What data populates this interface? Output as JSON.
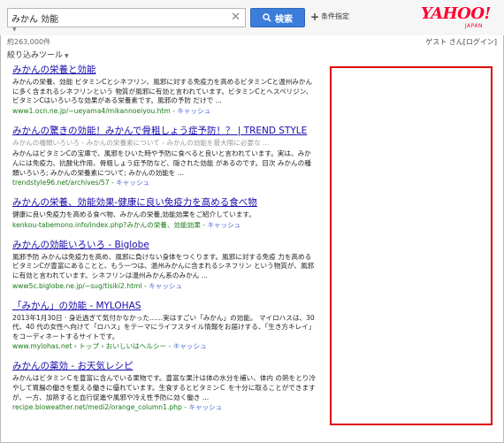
{
  "search": {
    "query": "みかん 効能",
    "button_label": "検索",
    "advanced_label": "条件指定"
  },
  "logo": {
    "text": "YAHOO!",
    "sub": "JAPAN"
  },
  "result_count": "約263,000件",
  "user": {
    "name": "ゲスト さん",
    "login": "[ログイン]"
  },
  "filter_label": "絞り込みツール",
  "results": [
    {
      "title": "みかんの栄養と効能",
      "snippet": "みかんの栄養、効能 ビタミンCとシネフリン、風邪に対する免疫力を高めるビタミンCと温州みかんに多く含まれるシネフリンという 物質が風邪に有効と言われています。ビタミンCとヘスペリジン、ビタミンCはいろいろな効果がある栄養素です。風邪の予防 だけで ...",
      "url": "www1.ocn.ne.jp/~ueyama4/mikannoeiyou.htm",
      "cache": "キャッシュ"
    },
    {
      "title": "みかんの驚きの効能！みかんで骨粗しょう症予防！？ | TREND STYLE",
      "sublinks": "みかんの種類いろいろ - みかんの栄養素について - みかんの効能を最大限に必要な ...",
      "snippet": "みかんはビタミンCの宝庫で、風邪をひいた時や予防に食べると良いと言われています。実は、みかんには免疫力、抗酸化作用、骨粗しょう症予防など、隠された効能 があるのです。目次 みかんの種類いろいろ; みかんの栄養素について; みかんの効能を ...",
      "url": "trendstyle96.net/archives/57",
      "cache": "キャッシュ"
    },
    {
      "title": "みかんの栄養、効能効果-健康に良い免疫力を高める食べ物",
      "snippet": "健康に良い免疫力を高める食べ物、みかんの栄養,効能効果をご紹介しています。",
      "url": "kenkou-tabemono.info/index.php?みかんの栄養、効能効果",
      "cache": "キャッシュ"
    },
    {
      "title": "みかんの効能いろいろ - Biglobe",
      "snippet": "風邪予防 みかんは免疫力を高め、風邪に負けない身体をつくります。風邪に対する免疫 力を高めるビタミンCが豊富にあることと、もう一つは、温州みかんに含まれるシネフリン という物質が、風邪に有効と言われています。シネフリンは温州みかん系のみかん ...",
      "url": "www5c.biglobe.ne.jp/~sug/tisiki2.html",
      "cache": "キャッシュ"
    },
    {
      "title": "「みかん」の効能 - MYLOHAS",
      "snippet": "2013年1月30日 · 身近過ぎて気付かなかった……実はすごい「みかん」の効能。 マイロハスは、30代、40 代の女性へ向けて「ロハス」をテーマにライフスタイル情報をお届けする、「生き方キレイ」をコーディネートするサイトです。",
      "url": "www.mylohas.net › トップ › おいしいはヘルシー",
      "cache": "キャッシュ"
    },
    {
      "title": "みかんの薬効 - お天気レシピ",
      "snippet": "みかんはビタミンＣを豊富に含んでいる果物です。豊富な果汁は体の水分を補い、体内 の熱をとり冷やして胃腸の働きを整える働きに優れています。生食するとビタミンＣ を十分に取ることができますが、一方、加熱すると血行促進や風邪や冷え性予防に効く働き ...",
      "url": "recipe.bioweather.net/medi2/orange_column1.php",
      "cache": "キャッシュ"
    }
  ]
}
